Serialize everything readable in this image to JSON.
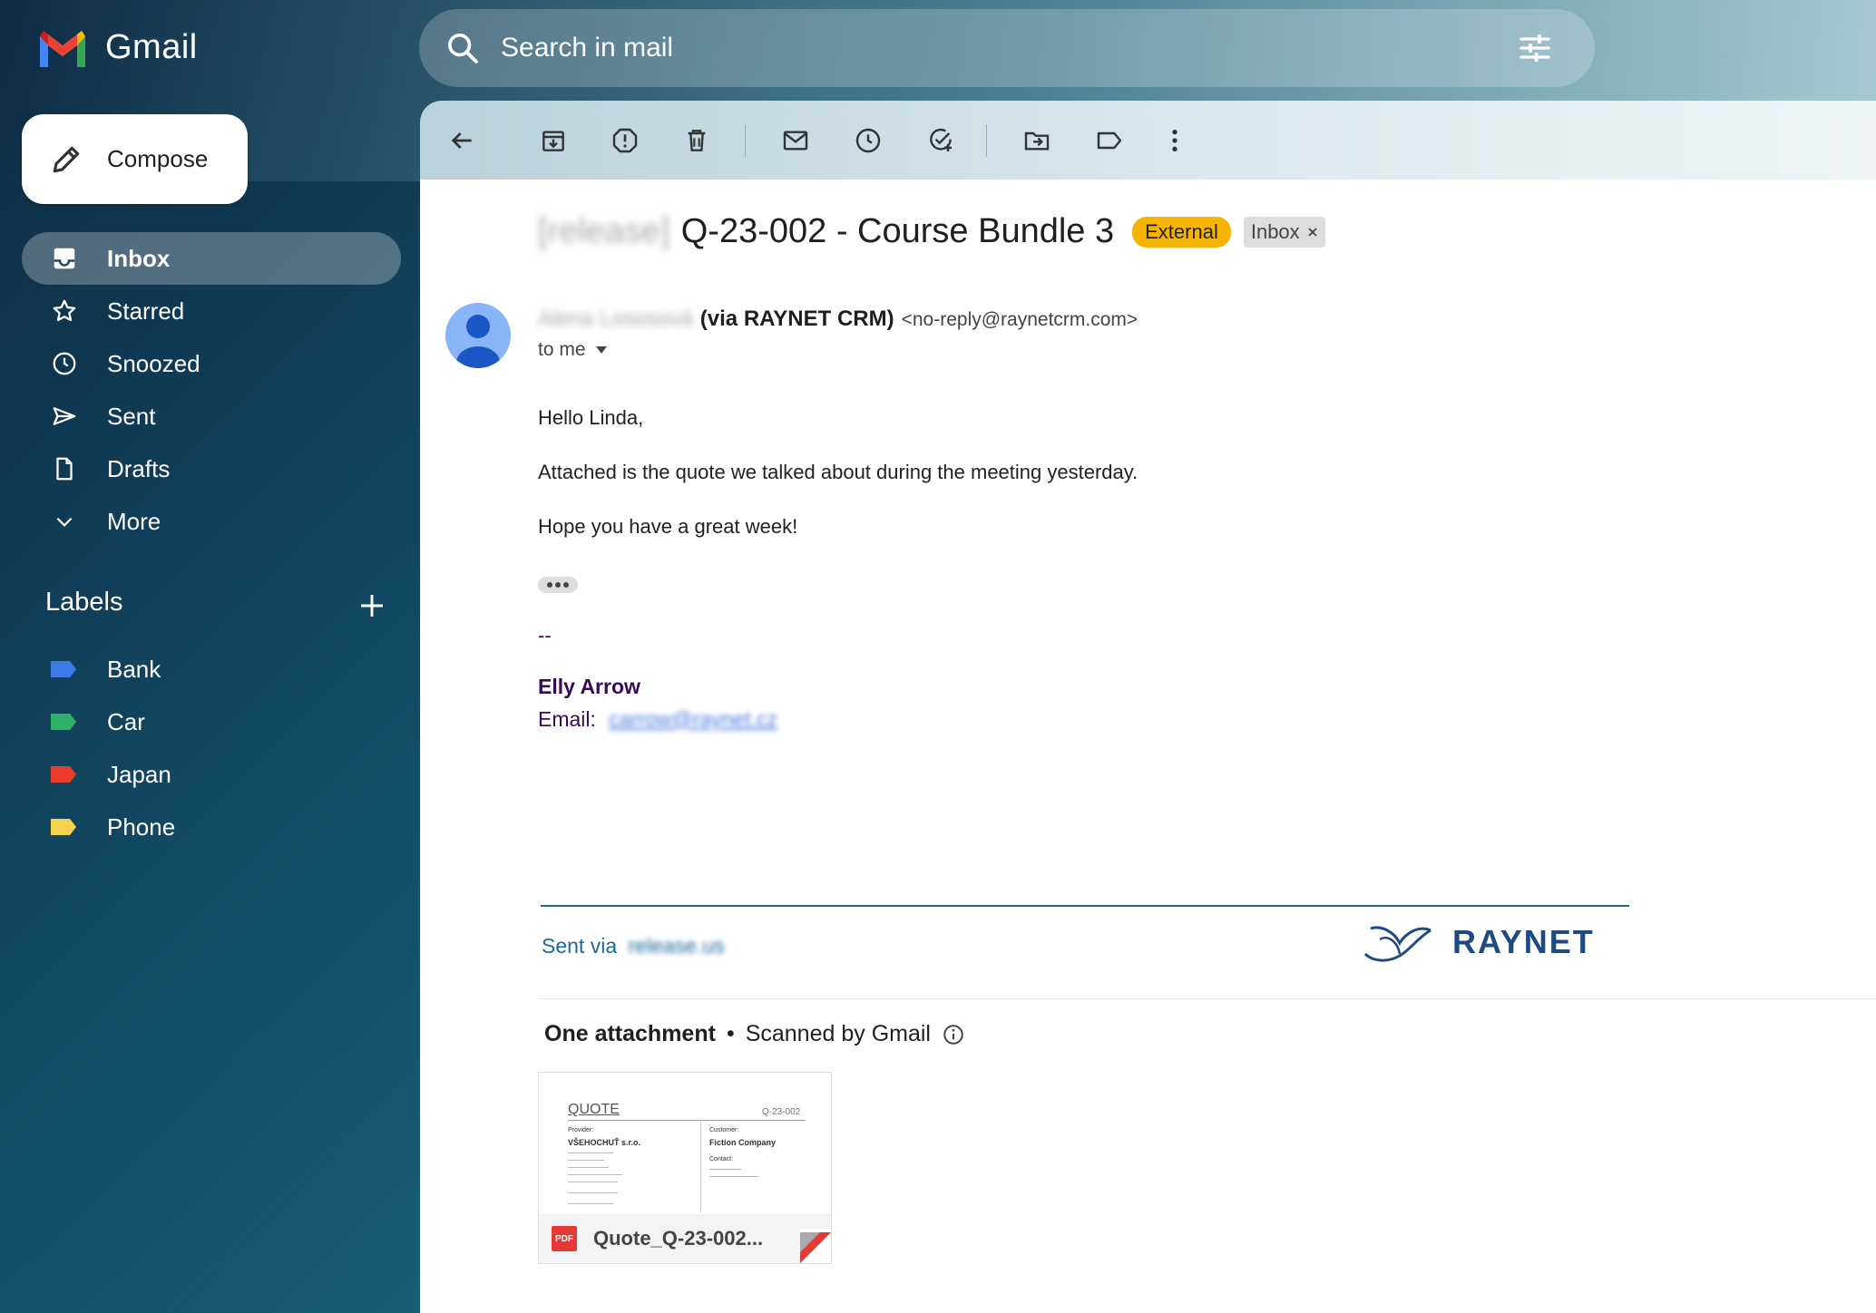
{
  "app": {
    "name": "Gmail"
  },
  "search": {
    "placeholder": "Search in mail"
  },
  "compose": {
    "label": "Compose"
  },
  "nav": [
    {
      "label": "Inbox",
      "icon": "inbox-icon",
      "active": true
    },
    {
      "label": "Starred",
      "icon": "star-icon"
    },
    {
      "label": "Snoozed",
      "icon": "clock-icon"
    },
    {
      "label": "Sent",
      "icon": "send-icon"
    },
    {
      "label": "Drafts",
      "icon": "draft-icon"
    },
    {
      "label": "More",
      "icon": "chevron-down-icon"
    }
  ],
  "labels": {
    "heading": "Labels",
    "items": [
      {
        "label": "Bank",
        "color": "#3d7be6"
      },
      {
        "label": "Car",
        "color": "#2fb16a"
      },
      {
        "label": "Japan",
        "color": "#ea3c2a"
      },
      {
        "label": "Phone",
        "color": "#f4d44d"
      }
    ]
  },
  "email": {
    "subject_prefix": "[release]",
    "subject": "Q-23-002 - Course Bundle 3",
    "badge_external": "External",
    "badge_inbox": "Inbox",
    "sender_name": "Alena Lososová",
    "sender_via": "(via RAYNET CRM)",
    "sender_email": "<no-reply@raynetcrm.com>",
    "to": "to me",
    "body": [
      "Hello Linda,",
      "Attached is the quote we talked about during the meeting yesterday.",
      "Hope you have a great week!"
    ],
    "sig_dash": "--",
    "sig_name": "Elly Arrow",
    "sig_email_label": "Email:",
    "sig_email": "carrow@raynet.cz",
    "sent_via": "Sent via",
    "sent_via_link": "release.us",
    "brand": "RAYNET"
  },
  "attachments": {
    "heading": "One attachment",
    "scanned": "Scanned by Gmail",
    "file_name": "Quote_Q-23-002...",
    "file_type": "PDF",
    "preview": {
      "title": "QUOTE",
      "number": "Q-23-002",
      "provider_label": "Provider:",
      "provider": "VŠEHOCHUŤ s.r.o.",
      "customer_label": "Customer:",
      "customer": "Fiction Company",
      "contact_label": "Contact:"
    }
  }
}
